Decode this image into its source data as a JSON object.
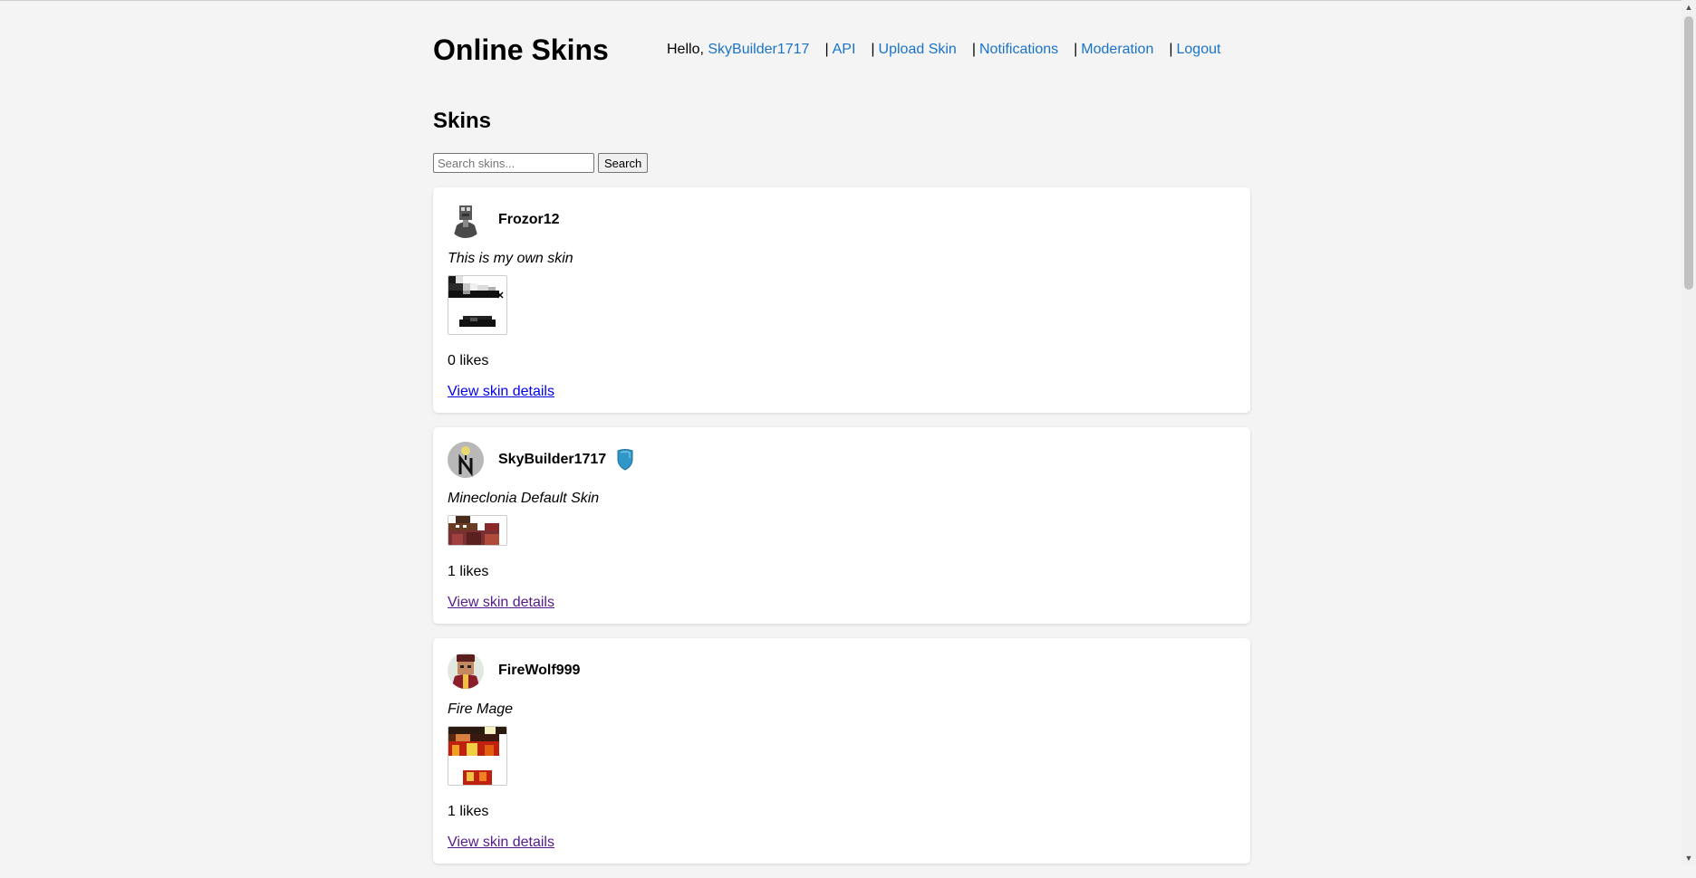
{
  "site": {
    "title": "Online Skins"
  },
  "nav": {
    "greeting": "Hello, ",
    "username": "SkyBuilder1717",
    "separator": "|",
    "links": [
      "API",
      "Upload Skin",
      "Notifications",
      "Moderation",
      "Logout"
    ]
  },
  "main": {
    "section_title": "Skins",
    "search": {
      "placeholder": "Search skins...",
      "button_label": "Search"
    },
    "skins": [
      {
        "author": "Frozor12",
        "description": "This is my own skin",
        "likes": "0 likes",
        "details_label": "View skin details"
      },
      {
        "author": "SkyBuilder1717",
        "description": "Mineclonia Default Skin",
        "likes": "1 likes",
        "details_label": "View skin details"
      },
      {
        "author": "FireWolf999",
        "description": "Fire Mage",
        "likes": "1 likes",
        "details_label": "View skin details"
      }
    ]
  },
  "colors": {
    "link": "#1a73c8",
    "background": "#f4f4f4",
    "badge": "#2f98c9"
  },
  "icons": {
    "moderator_badge": "shield-icon"
  }
}
